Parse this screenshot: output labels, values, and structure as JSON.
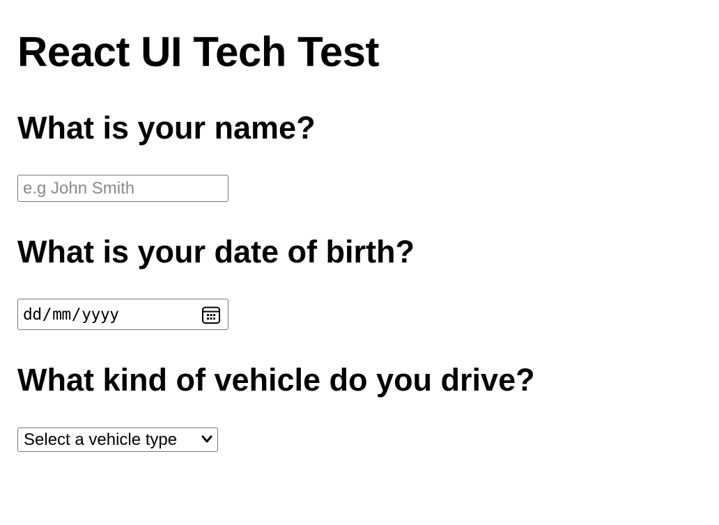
{
  "page": {
    "title": "React UI Tech Test"
  },
  "questions": {
    "name": {
      "label": "What is your name?",
      "placeholder": "e.g John Smith",
      "value": ""
    },
    "dob": {
      "label": "What is your date of birth?",
      "day_placeholder": "dd",
      "month_placeholder": "mm",
      "year_placeholder": "yyyy",
      "separator": "/",
      "icon": "calendar-icon"
    },
    "vehicle": {
      "label": "What kind of vehicle do you drive?",
      "selected": "Select a vehicle type",
      "icon": "chevron-down-icon"
    }
  },
  "colors": {
    "text": "#000000",
    "placeholder": "#8a8a8a",
    "field_border": "#767676",
    "background": "#ffffff"
  }
}
